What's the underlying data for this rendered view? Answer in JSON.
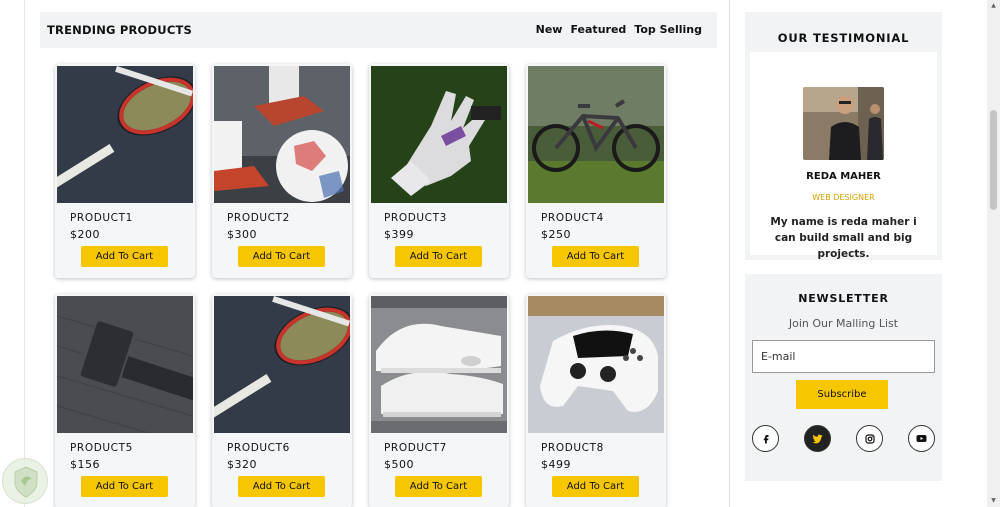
{
  "section": {
    "title": "TRENDING PRODUCTS",
    "tabs": [
      "New",
      "Featured",
      "Top Selling"
    ]
  },
  "products": [
    {
      "name": "PRODUCT1",
      "price": "$200",
      "button": "Add To Cart",
      "image": "tennis-racket"
    },
    {
      "name": "PRODUCT2",
      "price": "$300",
      "button": "Add To Cart",
      "image": "soccer-ball"
    },
    {
      "name": "PRODUCT3",
      "price": "$399",
      "button": "Add To Cart",
      "image": "goalkeeper-glove"
    },
    {
      "name": "PRODUCT4",
      "price": "$250",
      "button": "Add To Cart",
      "image": "mountain-bike"
    },
    {
      "name": "PRODUCT5",
      "price": "$156",
      "button": "Add To Cart",
      "image": "dumbbell"
    },
    {
      "name": "PRODUCT6",
      "price": "$320",
      "button": "Add To Cart",
      "image": "tennis-racket"
    },
    {
      "name": "PRODUCT7",
      "price": "$500",
      "button": "Add To Cart",
      "image": "sneakers"
    },
    {
      "name": "PRODUCT8",
      "price": "$499",
      "button": "Add To Cart",
      "image": "game-controller"
    }
  ],
  "testimonial": {
    "title": "OUR TESTIMONIAL",
    "name": "REDA MAHER",
    "role": "WEB DESIGNER",
    "quote": "My name is reda maher i can build small and big projects."
  },
  "newsletter": {
    "title": "NEWSLETTER",
    "subtitle": "Join Our Malling List",
    "email_placeholder": "E-mail",
    "button": "Subscribe",
    "socials": [
      "facebook-icon",
      "twitter-icon",
      "instagram-icon",
      "youtube-icon"
    ]
  },
  "colors": {
    "accent": "#f6c600",
    "panel": "#f1f3f5",
    "page_background": "#2e71b5"
  }
}
